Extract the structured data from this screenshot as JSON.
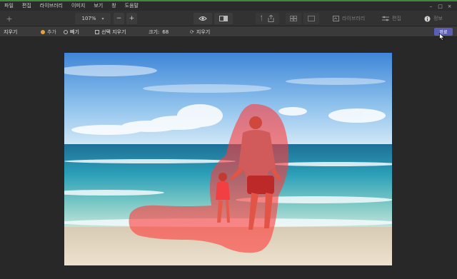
{
  "menu": [
    "파일",
    "편집",
    "라이브러리",
    "이미지",
    "보기",
    "창",
    "도움말"
  ],
  "window_controls": [
    "–",
    "□",
    "×"
  ],
  "toolbar": {
    "add_label": "+",
    "zoom_value": "107%",
    "zoom_out": "−",
    "zoom_in": "+",
    "library_label": "라이브러리",
    "edit_label": "편집",
    "info_label": "정보"
  },
  "options": {
    "tool_name": "지우기",
    "add_label": "추가",
    "subtract_label": "빼기",
    "erase_selection_label": "선택 지우기",
    "size_label": "크기:",
    "size_value": "68",
    "clear_label": "지우기",
    "done_label": "완료"
  },
  "colors": {
    "accent": "#5a5fb3",
    "mask": "#ff3b3b",
    "add_dot": "#e6a23c"
  }
}
